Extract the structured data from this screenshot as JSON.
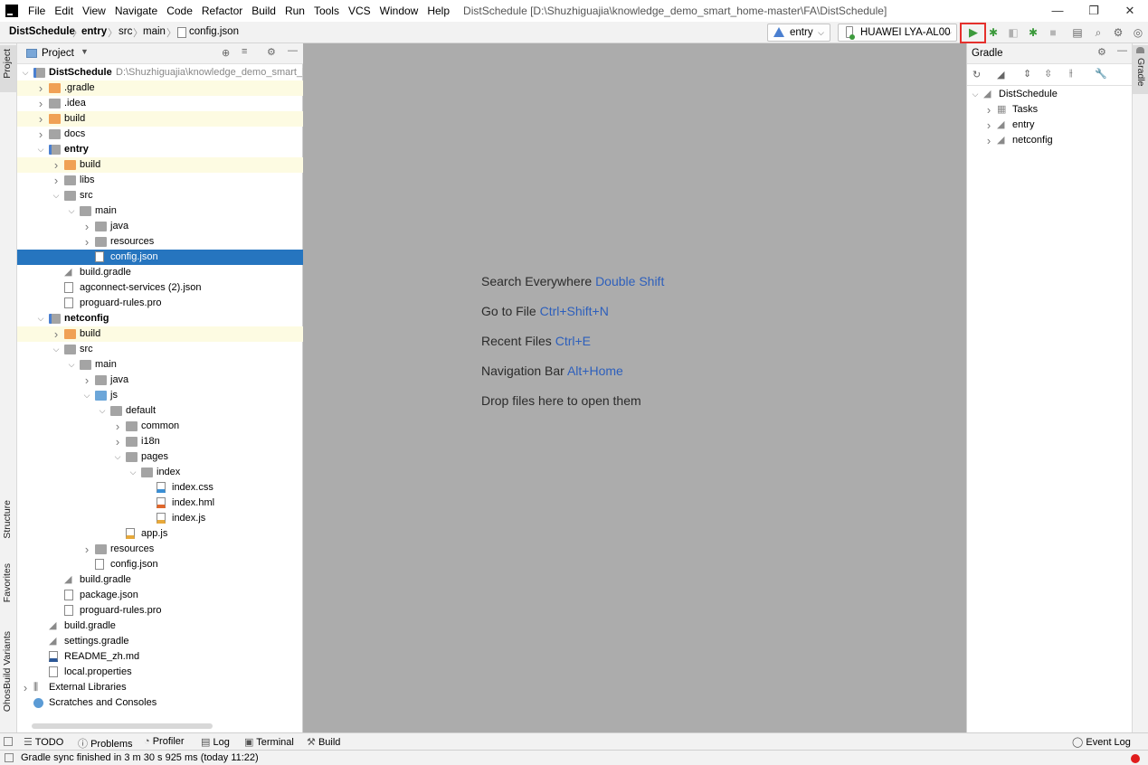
{
  "menu": [
    "File",
    "Edit",
    "View",
    "Navigate",
    "Code",
    "Refactor",
    "Build",
    "Run",
    "Tools",
    "VCS",
    "Window",
    "Help"
  ],
  "window_title": "DistSchedule [D:\\Shuzhiguajia\\knowledge_demo_smart_home-master\\FA\\DistSchedule]",
  "window_buttons": {
    "minimize": "—",
    "maximize": "❐",
    "close": "✕"
  },
  "breadcrumb": [
    "DistSchedule",
    "entry",
    "src",
    "main",
    "config.json"
  ],
  "toolbar": {
    "module": "entry",
    "device": "HUAWEI LYA-AL00"
  },
  "left_strip": {
    "project": "Project",
    "structure": "Structure",
    "favorites": "Favorites",
    "ohos": "OhosBuild Variants"
  },
  "project_panel": {
    "title": "Project"
  },
  "tree": [
    {
      "depth": 0,
      "arrow": "v",
      "icon": "module",
      "label": "DistSchedule",
      "bold": true,
      "path": "D:\\Shuzhiguajia\\knowledge_demo_smart_ho"
    },
    {
      "depth": 1,
      "arrow": ">",
      "icon": "folder-orange",
      "label": ".gradle",
      "hl": true
    },
    {
      "depth": 1,
      "arrow": ">",
      "icon": "folder",
      "label": ".idea"
    },
    {
      "depth": 1,
      "arrow": ">",
      "icon": "folder-orange",
      "label": "build",
      "hl": true
    },
    {
      "depth": 1,
      "arrow": ">",
      "icon": "folder",
      "label": "docs"
    },
    {
      "depth": 1,
      "arrow": "v",
      "icon": "module",
      "label": "entry",
      "bold": true
    },
    {
      "depth": 2,
      "arrow": ">",
      "icon": "folder-orange",
      "label": "build",
      "hl": true
    },
    {
      "depth": 2,
      "arrow": ">",
      "icon": "folder",
      "label": "libs"
    },
    {
      "depth": 2,
      "arrow": "v",
      "icon": "folder",
      "label": "src"
    },
    {
      "depth": 3,
      "arrow": "v",
      "icon": "folder",
      "label": "main"
    },
    {
      "depth": 4,
      "arrow": ">",
      "icon": "folder",
      "label": "java"
    },
    {
      "depth": 4,
      "arrow": ">",
      "icon": "folder",
      "label": "resources"
    },
    {
      "depth": 4,
      "arrow": "",
      "icon": "json",
      "label": "config.json",
      "sel": true
    },
    {
      "depth": 2,
      "arrow": "",
      "icon": "gradle",
      "label": "build.gradle"
    },
    {
      "depth": 2,
      "arrow": "",
      "icon": "json",
      "label": "agconnect-services (2).json"
    },
    {
      "depth": 2,
      "arrow": "",
      "icon": "file",
      "label": "proguard-rules.pro"
    },
    {
      "depth": 1,
      "arrow": "v",
      "icon": "module",
      "label": "netconfig",
      "bold": true
    },
    {
      "depth": 2,
      "arrow": ">",
      "icon": "folder-orange",
      "label": "build",
      "hl": true
    },
    {
      "depth": 2,
      "arrow": "v",
      "icon": "folder",
      "label": "src"
    },
    {
      "depth": 3,
      "arrow": "v",
      "icon": "folder",
      "label": "main"
    },
    {
      "depth": 4,
      "arrow": ">",
      "icon": "folder",
      "label": "java"
    },
    {
      "depth": 4,
      "arrow": "v",
      "icon": "folder-blue",
      "label": "js"
    },
    {
      "depth": 5,
      "arrow": "v",
      "icon": "folder",
      "label": "default"
    },
    {
      "depth": 6,
      "arrow": ">",
      "icon": "folder",
      "label": "common"
    },
    {
      "depth": 6,
      "arrow": ">",
      "icon": "folder",
      "label": "i18n"
    },
    {
      "depth": 6,
      "arrow": "v",
      "icon": "folder",
      "label": "pages"
    },
    {
      "depth": 7,
      "arrow": "v",
      "icon": "folder",
      "label": "index"
    },
    {
      "depth": 8,
      "arrow": "",
      "icon": "css",
      "label": "index.css"
    },
    {
      "depth": 8,
      "arrow": "",
      "icon": "html",
      "label": "index.hml"
    },
    {
      "depth": 8,
      "arrow": "",
      "icon": "js",
      "label": "index.js"
    },
    {
      "depth": 6,
      "arrow": "",
      "icon": "js",
      "label": "app.js"
    },
    {
      "depth": 4,
      "arrow": ">",
      "icon": "folder",
      "label": "resources"
    },
    {
      "depth": 4,
      "arrow": "",
      "icon": "json",
      "label": "config.json"
    },
    {
      "depth": 2,
      "arrow": "",
      "icon": "gradle",
      "label": "build.gradle"
    },
    {
      "depth": 2,
      "arrow": "",
      "icon": "json",
      "label": "package.json"
    },
    {
      "depth": 2,
      "arrow": "",
      "icon": "file",
      "label": "proguard-rules.pro"
    },
    {
      "depth": 1,
      "arrow": "",
      "icon": "gradle",
      "label": "build.gradle"
    },
    {
      "depth": 1,
      "arrow": "",
      "icon": "gradle",
      "label": "settings.gradle"
    },
    {
      "depth": 1,
      "arrow": "",
      "icon": "md",
      "label": "README_zh.md"
    },
    {
      "depth": 1,
      "arrow": "",
      "icon": "file",
      "label": "local.properties"
    },
    {
      "depth": 0,
      "arrow": ">",
      "icon": "library",
      "label": "External Libraries"
    },
    {
      "depth": 0,
      "arrow": "",
      "icon": "scratch",
      "label": "Scratches and Consoles"
    }
  ],
  "editor_hints": [
    {
      "text": "Search Everywhere",
      "key": "Double Shift"
    },
    {
      "text": "Go to File",
      "key": "Ctrl+Shift+N"
    },
    {
      "text": "Recent Files",
      "key": "Ctrl+E"
    },
    {
      "text": "Navigation Bar",
      "key": "Alt+Home"
    },
    {
      "text": "Drop files here to open them",
      "key": ""
    }
  ],
  "gradle_panel": {
    "title": "Gradle",
    "strip_label": "Gradle",
    "tree": [
      {
        "depth": 0,
        "arrow": "v",
        "label": "DistSchedule"
      },
      {
        "depth": 1,
        "arrow": ">",
        "label": "Tasks"
      },
      {
        "depth": 1,
        "arrow": ">",
        "label": "entry"
      },
      {
        "depth": 1,
        "arrow": ">",
        "label": "netconfig"
      }
    ]
  },
  "bottom_tabs": [
    "TODO",
    "Problems",
    "Profiler",
    "Log",
    "Terminal",
    "Build"
  ],
  "event_log": "Event Log",
  "status_text": "Gradle sync finished in 3 m 30 s 925 ms (today 11:22)",
  "colors": {
    "selection": "#2675bf",
    "highlight_box": "#e5302c",
    "run_green": "#3c9a3c",
    "shortcut_blue": "#2d5fbc"
  }
}
